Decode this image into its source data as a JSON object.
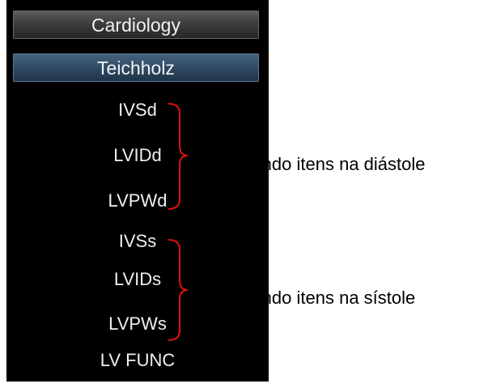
{
  "menu": {
    "category_button": "Cardiology",
    "method_button": "Teichholz",
    "items": [
      {
        "label": "IVSd"
      },
      {
        "label": "LVIDd"
      },
      {
        "label": "LVPWd"
      },
      {
        "label": "IVSs"
      },
      {
        "label": "LVIDs"
      },
      {
        "label": "LVPWs"
      },
      {
        "label": "LV FUNC"
      }
    ]
  },
  "annotations": {
    "diastole": "Medindo itens na diástole",
    "systole": "Medindo itens na sístole"
  },
  "colors": {
    "panel_background": "#000000",
    "selected_button": "#2f4a64",
    "brace": "#e01010",
    "menu_text": "#f0f0f0"
  }
}
